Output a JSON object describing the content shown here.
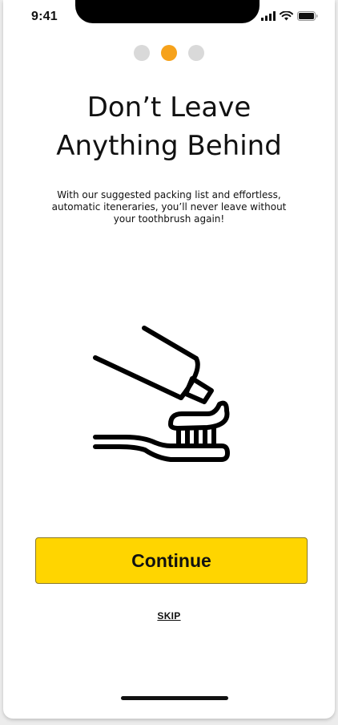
{
  "status_bar": {
    "time": "9:41",
    "icons": [
      "cellular-signal-icon",
      "wifi-icon",
      "battery-icon"
    ]
  },
  "pager": {
    "total": 3,
    "active_index": 1,
    "active_color": "#f6a21b",
    "inactive_color": "#d9d9d9"
  },
  "onboarding": {
    "title_line1": "Don’t Leave",
    "title_line2": "Anything Behind",
    "description": "With our suggested packing list and effortless, automatic iteneraries, you’ll never leave without your toothbrush again!",
    "illustration": "toothbrush-toothpaste-icon"
  },
  "actions": {
    "continue_label": "Continue",
    "skip_label": "SKIP",
    "primary_color": "#ffd500"
  }
}
